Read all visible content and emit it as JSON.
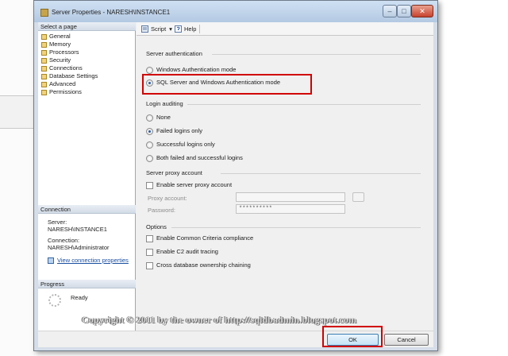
{
  "window": {
    "title": "Server Properties - NARESH\\INSTANCE1",
    "min_glyph": "‒",
    "max_glyph": "□",
    "close_glyph": "✕"
  },
  "select_page": {
    "header": "Select a page",
    "items": [
      {
        "label": "General"
      },
      {
        "label": "Memory"
      },
      {
        "label": "Processors"
      },
      {
        "label": "Security"
      },
      {
        "label": "Connections"
      },
      {
        "label": "Database Settings"
      },
      {
        "label": "Advanced"
      },
      {
        "label": "Permissions"
      }
    ]
  },
  "connection": {
    "header": "Connection",
    "server_label": "Server:",
    "server_value": "NARESH\\INSTANCE1",
    "connection_label": "Connection:",
    "connection_value": "NARESH\\Administrator",
    "view_link": "View connection properties"
  },
  "progress": {
    "header": "Progress",
    "status": "Ready"
  },
  "toolbar": {
    "script_label": "Script",
    "script_arrow": "▾",
    "help_label": "Help"
  },
  "server_auth": {
    "title": "Server authentication",
    "windows_mode": "Windows Authentication mode",
    "mixed_mode": "SQL Server and Windows Authentication mode",
    "selected": "mixed"
  },
  "login_auditing": {
    "title": "Login auditing",
    "options": [
      "None",
      "Failed logins only",
      "Successful logins only",
      "Both failed and successful logins"
    ],
    "selected": "Failed logins only"
  },
  "proxy": {
    "title": "Server proxy account",
    "enable_label": "Enable server proxy account",
    "proxy_account_label": "Proxy account:",
    "proxy_account_value": "",
    "password_label": "Password:",
    "password_value": "**********"
  },
  "options": {
    "title": "Options",
    "common_criteria": "Enable Common Criteria compliance",
    "c2_audit": "Enable C2 audit tracing",
    "cross_db": "Cross database ownership chaining"
  },
  "buttons": {
    "ok": "OK",
    "cancel": "Cancel"
  },
  "watermark": "Copyright © 2011 by the owner of http://sqldbadmin.blogspot.com",
  "colors": {
    "highlight": "#d10000",
    "link": "#1a4fa0"
  }
}
